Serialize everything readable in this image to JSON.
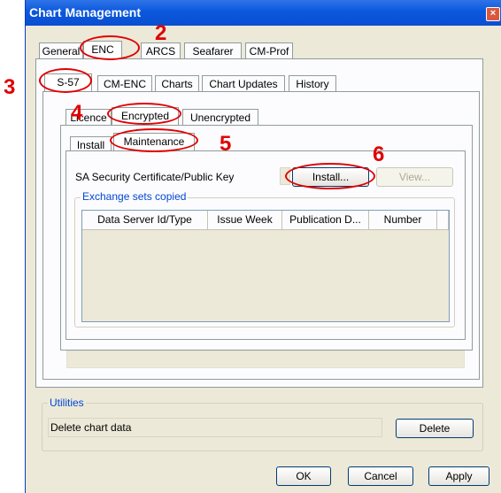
{
  "window": {
    "title": "Chart Management",
    "close_glyph": "×"
  },
  "top_tabs": [
    "General",
    "ENC",
    "ARCS",
    "Seafarer",
    "CM-Prof"
  ],
  "enc_tabs": [
    "S-57",
    "CM-ENC",
    "Charts",
    "Chart Updates",
    "History"
  ],
  "s57_tabs": [
    "Licence",
    "Encrypted",
    "Unencrypted"
  ],
  "encrypted_tabs": [
    "Install",
    "Maintenance"
  ],
  "maintenance": {
    "cert_label": "SA Security Certificate/Public Key",
    "install_button": "Install...",
    "view_button": "View...",
    "exchange_legend": "Exchange sets copied",
    "columns": [
      "Data Server Id/Type",
      "Issue Week",
      "Publication D...",
      "Number"
    ]
  },
  "utilities": {
    "legend": "Utilities",
    "delete_label": "Delete chart data",
    "delete_button": "Delete"
  },
  "footer": {
    "ok": "OK",
    "cancel": "Cancel",
    "apply": "Apply"
  },
  "markers": [
    "2",
    "3",
    "4",
    "5",
    "6"
  ],
  "colors": {
    "title_bar": "#0b58dd",
    "annotation": "#e00000",
    "legend_text": "#0046d5"
  }
}
